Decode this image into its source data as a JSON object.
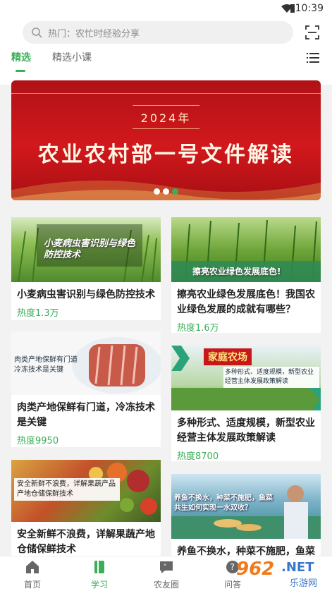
{
  "status": {
    "time": "10:39"
  },
  "search": {
    "placeholder": "热门：农忙时经验分享"
  },
  "tabs": [
    {
      "label": "精选"
    },
    {
      "label": "精选小课"
    }
  ],
  "banner": {
    "year": "2024年",
    "title": "农业农村部一号文件解读",
    "pages": 3,
    "active_page": 3
  },
  "cards": [
    {
      "title": "小麦病虫害识别与绿色防控技术",
      "heat": "热度1.3万",
      "image_text": "小麦病虫害识别与绿色防控技术"
    },
    {
      "title": "擦亮农业绿色发展底色！我国农业绿色发展的成就有哪些？",
      "heat": "热度1.6万",
      "image_text": "擦亮农业绿色发展底色!"
    },
    {
      "title": "肉类产地保鲜有门道，冷冻技术是关键",
      "heat": "热度9950",
      "image_text": "肉类产地保鲜有门道 冷冻技术是关键"
    },
    {
      "title": "多种形式、适度规模，新型农业经营主体发展政策解读",
      "heat": "热度8700",
      "image_text": "多种形式、适度规模，新型农业经营主体发展政策解读",
      "image_sign": "家庭农场"
    },
    {
      "title": "安全新鲜不浪费，详解果蔬产地仓储保鲜技术",
      "heat": "",
      "image_text": "安全新鲜不浪费，详解果蔬产品产地仓储保鲜技术"
    },
    {
      "title": "养鱼不换水，种菜不施肥，鱼菜",
      "heat": "",
      "image_text": "养鱼不换水，种菜不施肥，鱼菜共生如何实现一水双收？"
    }
  ],
  "nav": [
    {
      "label": "首页",
      "icon": "home-icon"
    },
    {
      "label": "学习",
      "icon": "book-icon"
    },
    {
      "label": "农友圈",
      "icon": "chat-icon"
    },
    {
      "label": "问答",
      "icon": "question-icon"
    }
  ],
  "watermark": {
    "text1": "962",
    "text2": ".NET",
    "text3": "乐游网"
  },
  "colors": {
    "accent": "#3cae5a",
    "banner_red": "#c8161b"
  }
}
